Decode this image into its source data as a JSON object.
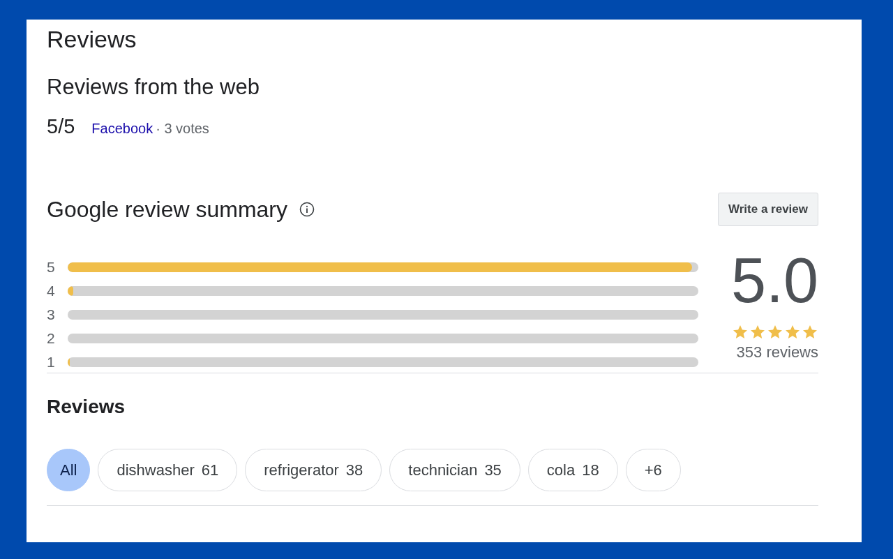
{
  "title": "Reviews",
  "web_reviews": {
    "heading": "Reviews from the web",
    "items": [
      {
        "score": "5/5",
        "source": "Facebook",
        "meta": "· 3 votes"
      }
    ]
  },
  "summary": {
    "heading": "Google review summary",
    "write_button": "Write a review",
    "rating": "5.0",
    "stars": 5,
    "count": "353 reviews",
    "bars": [
      {
        "label": "5",
        "level": 0.99
      },
      {
        "label": "4",
        "level": 0.009
      },
      {
        "label": "3"
      },
      {
        "label": "2"
      },
      {
        "label": "1",
        "level": 0.003
      }
    ]
  },
  "reviews": {
    "heading": "Reviews",
    "chips": [
      {
        "label": "All",
        "selected": true
      },
      {
        "label": "dishwasher",
        "count": "61",
        "selected": false
      },
      {
        "label": "refrigerator",
        "count": "38",
        "selected": false
      },
      {
        "label": "technician",
        "count": "35",
        "selected": false
      },
      {
        "label": "cola",
        "count": "18",
        "selected": false
      },
      {
        "label": "+6",
        "selected": false
      }
    ]
  }
}
